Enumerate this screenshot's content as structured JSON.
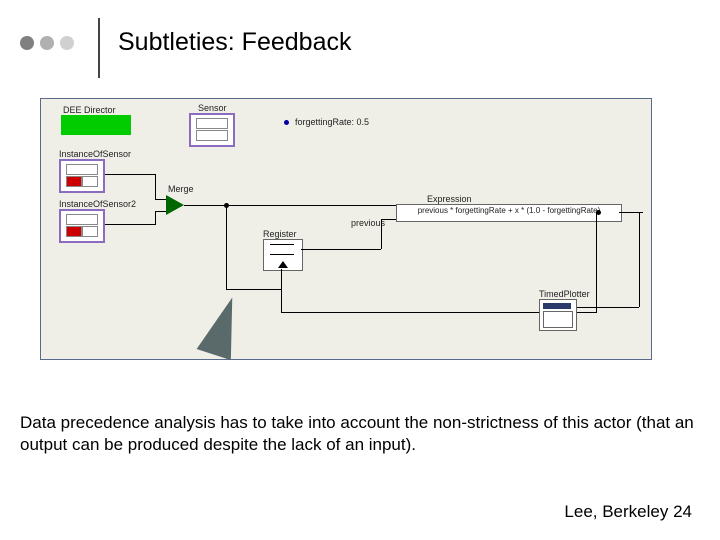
{
  "title": "Subtleties: Feedback",
  "diagram": {
    "director": "DEE Director",
    "sensor_header": "Sensor",
    "instance1": "InstanceOfSensor",
    "instance2": "InstanceOfSensor2",
    "merge": "Merge",
    "register": "Register",
    "expression_label": "Expression",
    "previous_label": "previous",
    "expression": "previous * forgettingRate + x * (1.0 - forgettingRate)",
    "plotter": "TimedPlotter",
    "forgetting": "forgettingRate: 0.5"
  },
  "caption": "Data precedence analysis has to take into account the non-strictness of this actor (that an output can be produced despite the lack of an input).",
  "footer": "Lee, Berkeley 24"
}
